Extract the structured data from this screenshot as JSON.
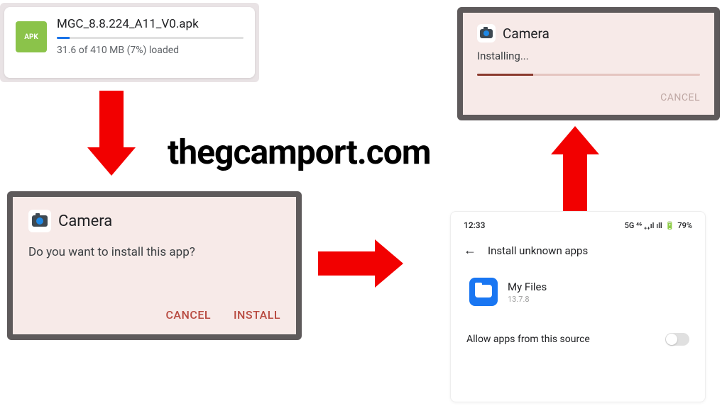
{
  "center_text": "thegcamport.com",
  "download": {
    "icon_label": "APK",
    "filename": "MGC_8.8.224_A11_V0.apk",
    "status_text": "31.6 of 410 MB (7%) loaded",
    "progress_pct": 7
  },
  "install_prompt": {
    "app_name": "Camera",
    "question": "Do you want to install this app?",
    "cancel_label": "CANCEL",
    "install_label": "INSTALL"
  },
  "installing": {
    "app_name": "Camera",
    "status": "Installing...",
    "cancel_label": "CANCEL"
  },
  "settings": {
    "time": "12:33",
    "battery": "79%",
    "network_icons": "5G ⁴⁶ ₊₊ıl ıll",
    "page_title": "Install unknown apps",
    "app_name": "My Files",
    "app_version": "13.7.8",
    "toggle_label": "Allow apps from this source",
    "toggle_on": false
  }
}
